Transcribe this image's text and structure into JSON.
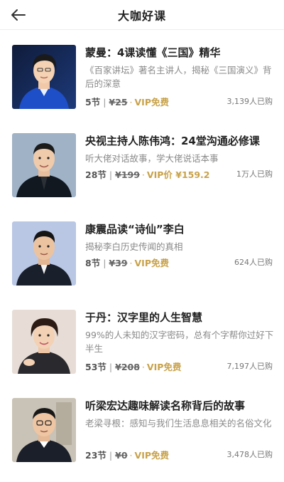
{
  "header": {
    "title": "大咖好课",
    "back_icon": "arrow-left-icon"
  },
  "courses": [
    {
      "title": "蒙曼：4课读懂《三国》精华",
      "desc": "《百家讲坛》著名主讲人，揭秘《三国演义》背后的深意",
      "lessons": "5节",
      "price": "¥25",
      "vip": "VIP免费",
      "buyers": "3,139人已购"
    },
    {
      "title": "央视主持人陈伟鸿：24堂沟通必修课",
      "desc": "听大佬对话故事，学大佬说话本事",
      "lessons": "28节",
      "price": "¥199",
      "vip": "VIP价 ¥159.2",
      "buyers": "1万人已购"
    },
    {
      "title": "康震品读“诗仙”李白",
      "desc": "揭秘李白历史传闻的真相",
      "lessons": "8节",
      "price": "¥39",
      "vip": "VIP免费",
      "buyers": "624人已购"
    },
    {
      "title": "于丹：汉字里的人生智慧",
      "desc": "99%的人未知的汉字密码，总有个字帮你过好下半生",
      "lessons": "53节",
      "price": "¥208",
      "vip": "VIP免费",
      "buyers": "7,197人已购"
    },
    {
      "title": "听梁宏达趣味解读名称背后的故事",
      "desc": "老梁寻根：感知与我们生活息息相关的名俗文化",
      "lessons": "23节",
      "price": "¥0",
      "vip": "VIP免费",
      "buyers": "3,478人已购"
    }
  ],
  "colors": {
    "vip_gold": "#c8a24a",
    "desc_gray": "#8a8a8a"
  }
}
